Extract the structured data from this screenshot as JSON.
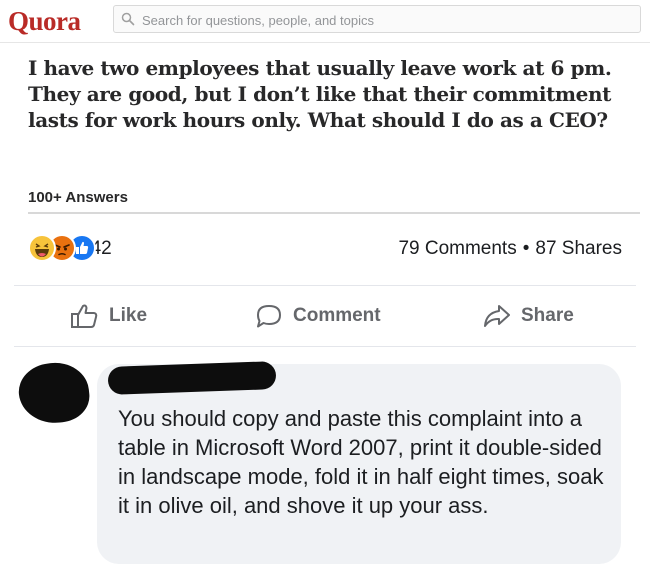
{
  "quora": {
    "logo": "Quora",
    "search_placeholder": "Search for questions, people, and topics",
    "question": "I have two employees that usually leave work at 6 pm. They are good, but I don’t like that their commitment lasts for work hours only. What should I do as a CEO?",
    "answers_count": "100+ Answers",
    "brand_color": "#b92b27"
  },
  "post": {
    "reaction_icons": [
      "haha-reaction-icon",
      "angry-reaction-icon",
      "like-reaction-icon"
    ],
    "reaction_count": "542",
    "comments_count": "79 Comments",
    "stats_separator": "•",
    "shares_count": "87 Shares",
    "actions": {
      "like_label": "Like",
      "comment_label": "Comment",
      "share_label": "Share"
    }
  },
  "comment": {
    "text": "You should copy and paste this complaint into a table in Microsoft Word 2007, print it double-sided in landscape mode, fold it in half eight times, soak it in olive oil, and shove it up your ass.",
    "bubble_color": "#f0f2f5"
  }
}
